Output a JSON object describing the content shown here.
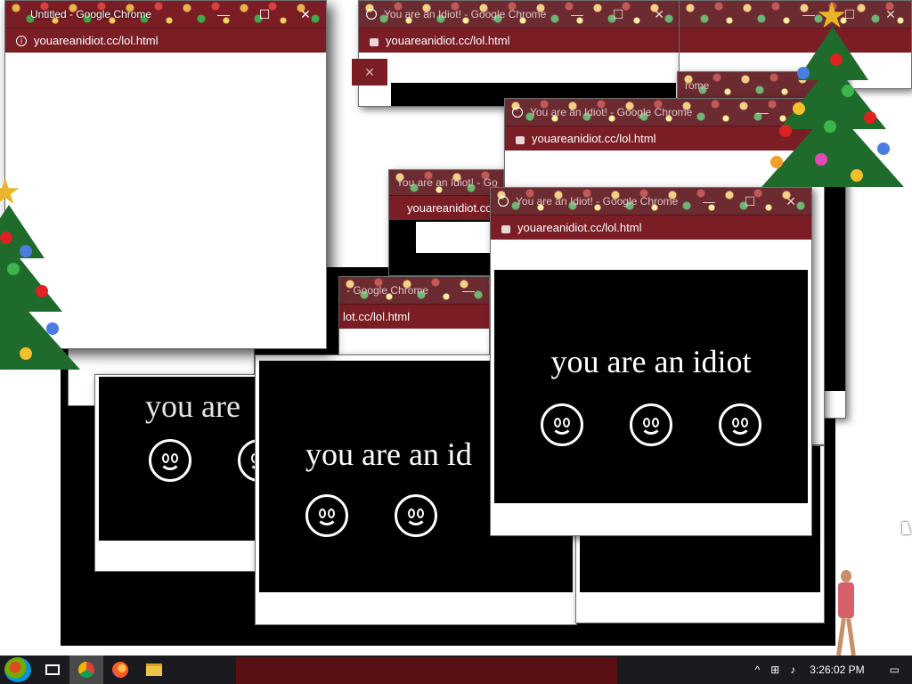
{
  "windows": {
    "untitled": {
      "title": "Untitled - Google Chrome",
      "url": "youareanidiot.cc/lol.html"
    },
    "idiot_title": "You are an Idiot! - Google Chrome",
    "idiot_url": "youareanidiot.cc/lol.html",
    "partial_title": "You are an Idiot! - Go",
    "partial_title_b": "- Google Chrome",
    "partial_url": "lot.cc/lol.html",
    "partial_url_b": "youareanidiot.cc/lol.html",
    "partial_tab": "rome"
  },
  "content": {
    "message": "you are an idiot",
    "message_partial": "you are an id",
    "message_cut": "you are"
  },
  "controls": {
    "minimize": "—",
    "maximize": "☐",
    "close": "✕"
  },
  "icons": {
    "start": "windows-start-icon",
    "task_view": "task-view-icon",
    "chrome": "chrome-icon",
    "firefox": "firefox-icon",
    "explorer": "folder-icon",
    "tree": "christmas-tree-icon"
  },
  "tray": {
    "chevron": "^",
    "network": "⊞",
    "volume": "♪",
    "time": "3:26:02 PM",
    "notifications": "▭"
  },
  "colors": {
    "titlebar": "#7a1d24",
    "desktop_black": "#000000",
    "taskbar": "#1b1b1f"
  }
}
